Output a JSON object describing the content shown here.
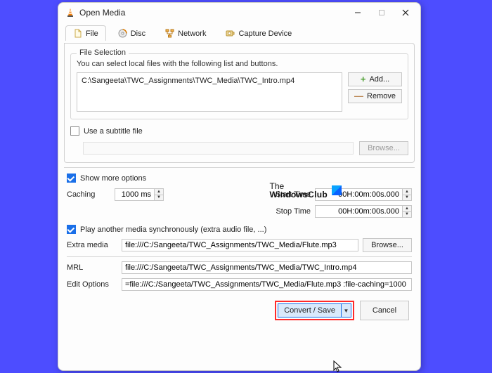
{
  "titlebar": {
    "title": "Open Media"
  },
  "tabs": {
    "file": "File",
    "disc": "Disc",
    "network": "Network",
    "capture": "Capture Device"
  },
  "file_selection": {
    "legend": "File Selection",
    "hint": "You can select local files with the following list and buttons.",
    "files": [
      "C:\\Sangeeta\\TWC_Assignments\\TWC_Media\\TWC_Intro.mp4"
    ],
    "add": "Add...",
    "remove": "Remove"
  },
  "subtitle": {
    "label": "Use a subtitle file",
    "browse": "Browse..."
  },
  "show_more": "Show more options",
  "caching": {
    "label": "Caching",
    "value": "1000 ms"
  },
  "start_time": {
    "label": "Start Time",
    "value": "00H:00m:00s.000"
  },
  "stop_time": {
    "label": "Stop Time",
    "value": "00H:00m:00s.000"
  },
  "sync": {
    "label": "Play another media synchronously (extra audio file, ...)",
    "extra_label": "Extra media",
    "extra_value": "file:///C:/Sangeeta/TWC_Assignments/TWC_Media/Flute.mp3",
    "browse": "Browse..."
  },
  "mrl": {
    "label": "MRL",
    "value": "file:///C:/Sangeeta/TWC_Assignments/TWC_Media/TWC_Intro.mp4"
  },
  "edit_options": {
    "label": "Edit Options",
    "value": "=file:///C:/Sangeeta/TWC_Assignments/TWC_Media/Flute.mp3 :file-caching=1000"
  },
  "footer": {
    "convert": "Convert / Save",
    "cancel": "Cancel"
  },
  "watermark": {
    "line1": "The",
    "line2": "WindowsClub"
  }
}
